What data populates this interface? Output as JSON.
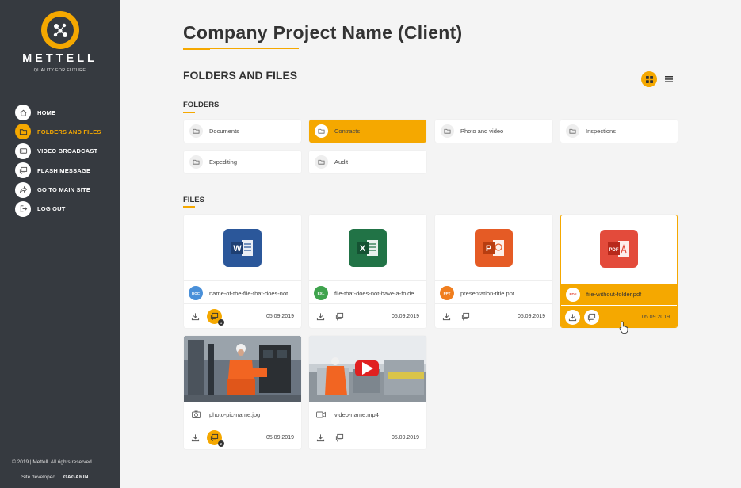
{
  "brand": {
    "name": "METTELL",
    "tagline": "QUALITY FOR FUTURE",
    "accent": "#f5a800",
    "sidebar_bg": "#363a40"
  },
  "nav": [
    {
      "label": "HOME",
      "icon": "home-icon",
      "active": false
    },
    {
      "label": "FOLDERS AND FILES",
      "icon": "folder-icon",
      "active": true
    },
    {
      "label": "VIDEO BROADCAST",
      "icon": "video-icon",
      "active": false
    },
    {
      "label": "FLASH MESSAGE",
      "icon": "message-icon",
      "active": false
    },
    {
      "label": "GO TO MAIN SITE",
      "icon": "share-icon",
      "active": false
    },
    {
      "label": "LOG OUT",
      "icon": "logout-icon",
      "active": false
    }
  ],
  "footer": {
    "copyright": "© 2019   |   Mettell. All rights reserved",
    "developed": "Site developed",
    "developer": "GAGARIN"
  },
  "page_title": "Company Project Name (Client)",
  "section_title": "FOLDERS AND FILES",
  "folders_title": "FOLDERS",
  "files_title": "FILES",
  "folders": [
    {
      "label": "Documents",
      "active": false
    },
    {
      "label": "Contracts",
      "active": true
    },
    {
      "label": "Photo and video",
      "active": false
    },
    {
      "label": "Inspections",
      "active": false
    },
    {
      "label": "Expediting",
      "active": false
    },
    {
      "label": "Audit",
      "active": false
    }
  ],
  "files": [
    {
      "name": "name-of-the-file-that-does-not-have-a-folder.doc",
      "badge": "DOC",
      "badge_color": "#4a90d9",
      "app": "word",
      "date": "05.09.2019",
      "comments": "1"
    },
    {
      "name": "file-that-does-not-have-a-folder.xls",
      "badge": "EXL",
      "badge_color": "#3fa34d",
      "app": "excel",
      "date": "05.09.2019",
      "comments": ""
    },
    {
      "name": "presentation-title.ppt",
      "badge": "PPT",
      "badge_color": "#f07e1e",
      "app": "powerpoint",
      "date": "05.09.2019",
      "comments": ""
    },
    {
      "name": "file-without-folder.pdf",
      "badge": "PDF",
      "badge_color": "#e34b3b",
      "app": "pdf",
      "date": "05.09.2019",
      "comments": ""
    },
    {
      "name": "photo-pic-name.jpg",
      "badge": "camera-icon",
      "app": "photo",
      "date": "05.09.2019",
      "comments": "2"
    },
    {
      "name": "video-name.mp4",
      "badge": "video-icon",
      "app": "video",
      "date": "05.09.2019",
      "comments": ""
    }
  ]
}
